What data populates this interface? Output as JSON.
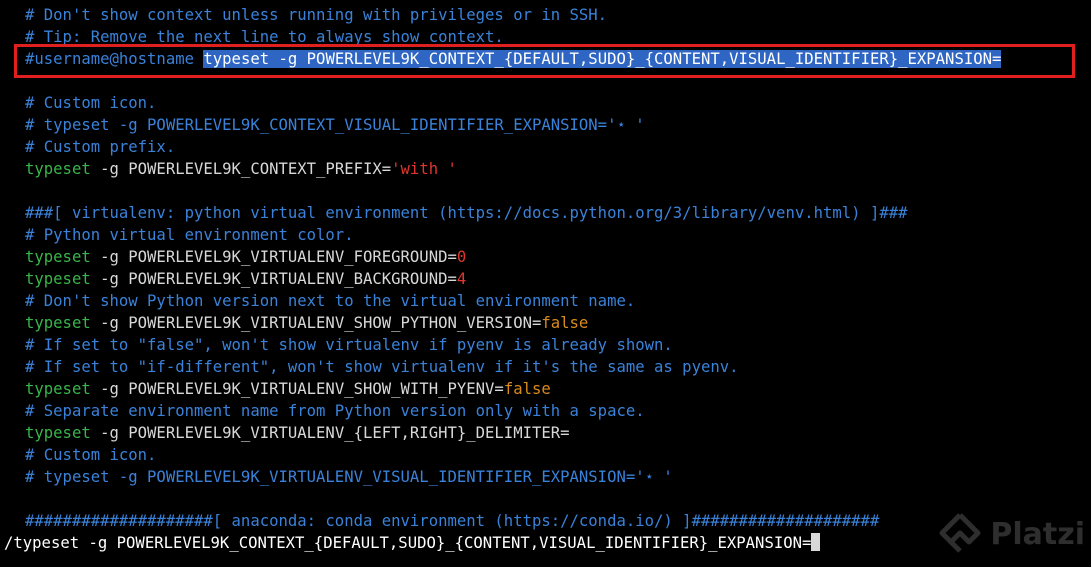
{
  "colors": {
    "background": "#000000",
    "comment": "#3a82d9",
    "keyword": "#39b54a",
    "text": "#d8d8d8",
    "number": "#e0362c",
    "boolean": "#d98a1c",
    "string": "#e0362c",
    "selection": "#2f66c4",
    "highlight_border": "#e01f1f"
  },
  "lines": {
    "l1": "# Don't show context unless running with privileges or in SSH.",
    "l2": "# Tip: Remove the next line to always show context.",
    "l3_user": "#username@hostname",
    "l3_sel": "typeset -g POWERLEVEL9K_CONTEXT_{DEFAULT,SUDO}_{CONTENT,VISUAL_IDENTIFIER}_EXPANSION=",
    "l5": "# Custom icon.",
    "l6": "# typeset -g POWERLEVEL9K_CONTEXT_VISUAL_IDENTIFIER_EXPANSION='⋆ '",
    "l7": "# Custom prefix.",
    "l8_kw": "typeset",
    "l8_rest": " -g POWERLEVEL9K_CONTEXT_PREFIX=",
    "l8_str": "'with '",
    "l10": "###[ virtualenv: python virtual environment (https://docs.python.org/3/library/venv.html) ]###",
    "l11": "# Python virtual environment color.",
    "l12_kw": "typeset",
    "l12_rest": " -g POWERLEVEL9K_VIRTUALENV_FOREGROUND=",
    "l12_val": "0",
    "l13_kw": "typeset",
    "l13_rest": " -g POWERLEVEL9K_VIRTUALENV_BACKGROUND=",
    "l13_val": "4",
    "l14": "# Don't show Python version next to the virtual environment name.",
    "l15_kw": "typeset",
    "l15_rest": " -g POWERLEVEL9K_VIRTUALENV_SHOW_PYTHON_VERSION=",
    "l15_val": "false",
    "l16": "# If set to \"false\", won't show virtualenv if pyenv is already shown.",
    "l17": "# If set to \"if-different\", won't show virtualenv if it's the same as pyenv.",
    "l18_kw": "typeset",
    "l18_rest": " -g POWERLEVEL9K_VIRTUALENV_SHOW_WITH_PYENV=",
    "l18_val": "false",
    "l19": "# Separate environment name from Python version only with a space.",
    "l20_kw": "typeset",
    "l20_rest": " -g POWERLEVEL9K_VIRTUALENV_{LEFT,RIGHT}_DELIMITER=",
    "l21": "# Custom icon.",
    "l22": "# typeset -g POWERLEVEL9K_VIRTUALENV_VISUAL_IDENTIFIER_EXPANSION='⋆ '",
    "l24": "####################[ anaconda: conda environment (https://conda.io/) ]####################"
  },
  "command_line": {
    "text": "/typeset -g POWERLEVEL9K_CONTEXT_{DEFAULT,SUDO}_{CONTENT,VISUAL_IDENTIFIER}_EXPANSION="
  },
  "watermark": {
    "text": "Platzi",
    "icon": "platzi-logo-icon"
  }
}
